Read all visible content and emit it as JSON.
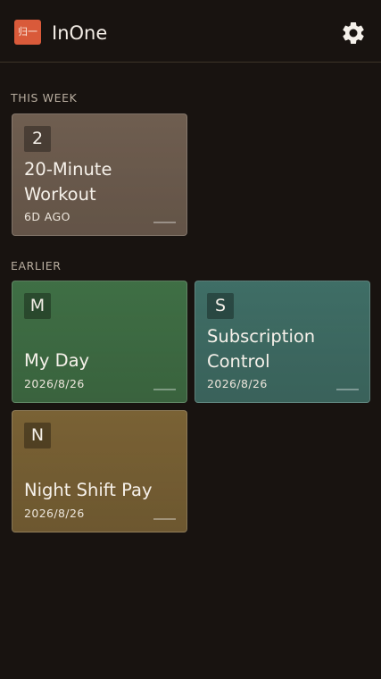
{
  "app": {
    "logo_text": "归一",
    "title": "InOne",
    "settings_icon": "gear-icon"
  },
  "sections": {
    "this_week": "THIS WEEK",
    "earlier": "EARLIER"
  },
  "cards": {
    "workout": {
      "badge": "2",
      "title": "20-Minute Workout",
      "meta": "6D AGO",
      "color": "#6f5e50"
    },
    "my_day": {
      "badge": "M",
      "title": "My Day",
      "meta": "2026/8/26",
      "color": "#3f6f45"
    },
    "subscription": {
      "badge": "S",
      "title": "Subscription Control",
      "meta": "2026/8/26",
      "color": "#3f6e66"
    },
    "night_shift": {
      "badge": "N",
      "title": "Night Shift Pay",
      "meta": "2026/8/26",
      "color": "#7a6235"
    }
  }
}
